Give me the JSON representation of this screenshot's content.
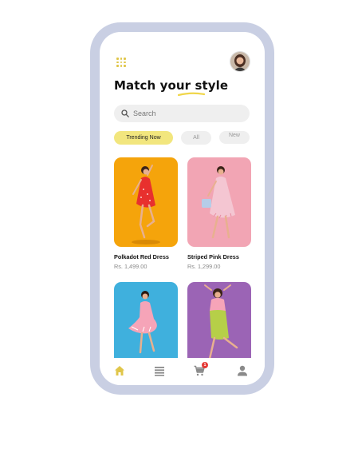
{
  "header": {
    "title_prefix": "Match your ",
    "title_highlight": "style"
  },
  "search": {
    "placeholder": "Search"
  },
  "filters": [
    {
      "label": "Trending Now",
      "active": true
    },
    {
      "label": "All",
      "active": false
    },
    {
      "label": "New",
      "active": false
    }
  ],
  "products": [
    {
      "name": "Polkadot Red Dress",
      "price": "Rs. 1,499.00",
      "bg": "#f5a40b",
      "dress": "#e8302e"
    },
    {
      "name": "Striped Pink Dress",
      "price": "Rs. 1,299.00",
      "bg": "#f2a5b4",
      "dress": "#f4c6d2"
    },
    {
      "name": "",
      "price": "",
      "bg": "#3fb0dd",
      "dress": "#f6a4b8"
    },
    {
      "name": "",
      "price": "",
      "bg": "#9b64b5",
      "dress": "#b6cf48"
    }
  ],
  "cart": {
    "badge_count": "1"
  },
  "colors": {
    "accent": "#f2e67e",
    "frame": "#c9cfe3",
    "nav_active": "#e0c64a",
    "nav_inactive": "#8a8a8a"
  },
  "nav": [
    "home-icon",
    "list-icon",
    "cart-icon",
    "profile-icon"
  ]
}
